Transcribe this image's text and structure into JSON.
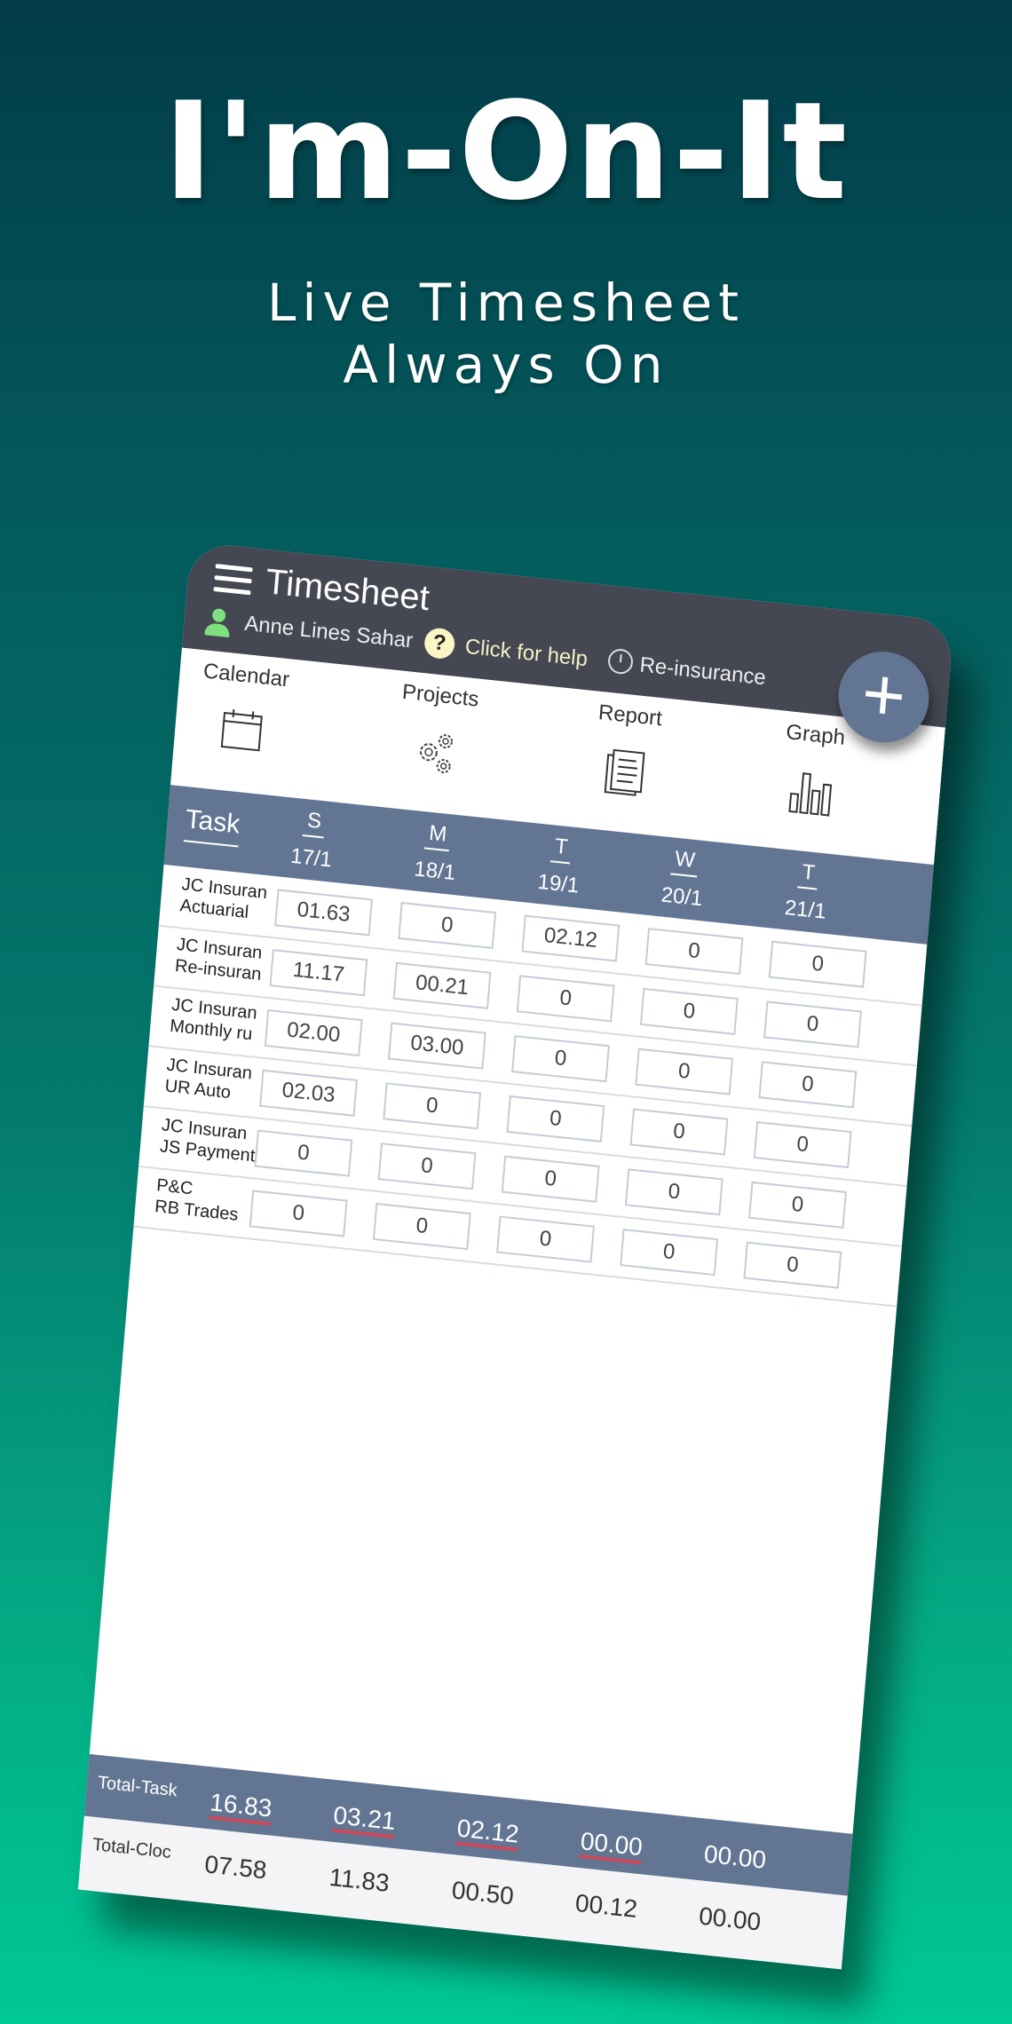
{
  "hero": {
    "title": "I'm-On-It",
    "subtitle_line1": "Live Timesheet",
    "subtitle_line2": "Always On"
  },
  "app": {
    "title": "Timesheet",
    "user_name": "Anne Lines Sahar",
    "help_label": "Click for help",
    "active_task": "Re-insurance",
    "fab_label": "+",
    "icons": {
      "menu": "hamburger-icon",
      "user": "user-icon",
      "help": "question-icon",
      "timer": "stopwatch-icon",
      "add": "plus-icon"
    }
  },
  "nav": [
    {
      "label": "Calendar",
      "icon": "calendar-icon"
    },
    {
      "label": "Projects",
      "icon": "gears-icon"
    },
    {
      "label": "Report",
      "icon": "report-icon"
    },
    {
      "label": "Graph",
      "icon": "bar-chart-icon"
    }
  ],
  "grid": {
    "task_header": "Task",
    "columns": [
      {
        "dow": "S",
        "date": "17/1"
      },
      {
        "dow": "M",
        "date": "18/1"
      },
      {
        "dow": "T",
        "date": "19/1"
      },
      {
        "dow": "W",
        "date": "20/1"
      },
      {
        "dow": "T",
        "date": "21/1"
      }
    ],
    "rows": [
      {
        "line1": "JC Insuran",
        "line2": "Actuarial",
        "values": [
          "01.63",
          "0",
          "02.12",
          "0",
          "0"
        ]
      },
      {
        "line1": "JC Insuran",
        "line2": "Re-insuran",
        "values": [
          "11.17",
          "00.21",
          "0",
          "0",
          "0"
        ]
      },
      {
        "line1": "JC Insuran",
        "line2": "Monthly ru",
        "values": [
          "02.00",
          "03.00",
          "0",
          "0",
          "0"
        ]
      },
      {
        "line1": "JC Insuran",
        "line2": "UR Auto",
        "values": [
          "02.03",
          "0",
          "0",
          "0",
          "0"
        ]
      },
      {
        "line1": "JC Insuran",
        "line2": "JS Payment",
        "values": [
          "0",
          "0",
          "0",
          "0",
          "0"
        ]
      },
      {
        "line1": "P&C",
        "line2": "RB Trades",
        "values": [
          "0",
          "0",
          "0",
          "0",
          "0"
        ]
      }
    ]
  },
  "totals": {
    "task_label": "Total-Task",
    "task_values": [
      "16.83",
      "03.21",
      "02.12",
      "00.00",
      "00.00"
    ],
    "clock_label": "Total-Cloc",
    "clock_values": [
      "07.58",
      "11.83",
      "00.50",
      "00.12",
      "00.00"
    ]
  },
  "colors": {
    "topbar": "#454853",
    "header_band": "#627592",
    "user_icon": "#7ee07e",
    "help_bg": "#fbf6c4",
    "underline_red": "#c9495b"
  }
}
